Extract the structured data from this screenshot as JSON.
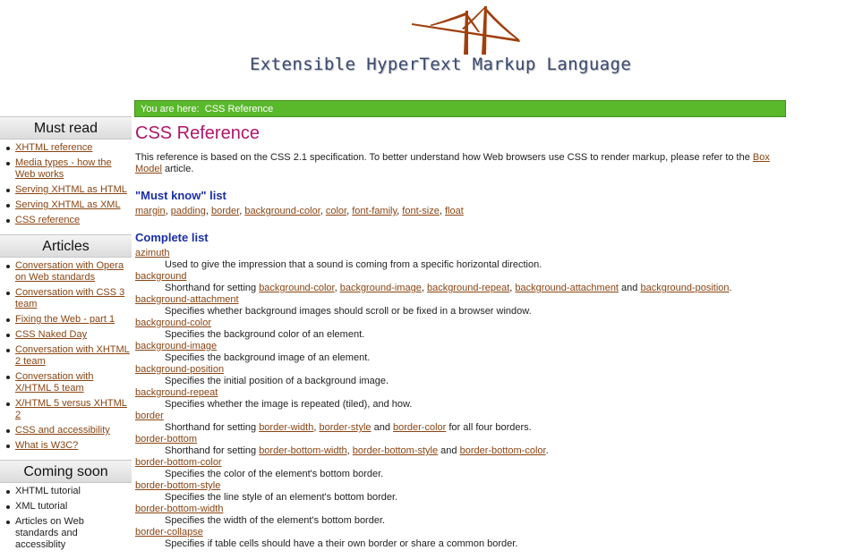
{
  "header": {
    "site_title": "Extensible HyperText Markup Language"
  },
  "breadcrumb": {
    "prefix": "You are here:",
    "current": "CSS Reference"
  },
  "sidebar": {
    "must_read": {
      "title": "Must read",
      "items": [
        "XHTML reference",
        "Media types - how the Web works",
        "Serving XHTML as HTML",
        "Serving XHTML as XML",
        "CSS reference"
      ]
    },
    "articles": {
      "title": "Articles",
      "items": [
        "Conversation with Opera on Web standards",
        "Conversation with CSS 3 team",
        "Fixing the Web - part 1",
        "CSS Naked Day",
        "Conversation with XHTML 2 team",
        "Conversation with X/HTML 5 team",
        "X/HTML 5 versus XHTML 2",
        "CSS and accessibility",
        "What is W3C?"
      ]
    },
    "coming_soon": {
      "title": "Coming soon",
      "items": [
        "XHTML tutorial",
        "XML tutorial",
        "Articles on Web standards and accessiblity"
      ]
    }
  },
  "main": {
    "title": "CSS Reference",
    "intro_pre": "This reference is based on the CSS 2.1 specification. To better understand how Web browsers use CSS to render markup, please refer to the",
    "intro_link": "Box Model",
    "intro_post": "article.",
    "must_know_heading": "\"Must know\" list",
    "must_know": [
      "margin",
      "padding",
      "border",
      "background-color",
      "color",
      "font-family",
      "font-size",
      "float"
    ],
    "complete_heading": "Complete list",
    "terms": [
      {
        "name": "azimuth",
        "desc": [
          {
            "t": "Used to give the impression that a sound is coming from a specific horizontal direction."
          }
        ]
      },
      {
        "name": "background",
        "desc": [
          {
            "t": "Shorthand for setting "
          },
          {
            "l": "background-color"
          },
          {
            "t": ", "
          },
          {
            "l": "background-image"
          },
          {
            "t": ", "
          },
          {
            "l": "background-repeat"
          },
          {
            "t": ", "
          },
          {
            "l": "background-attachment"
          },
          {
            "t": " and "
          },
          {
            "l": "background-position"
          },
          {
            "t": "."
          }
        ]
      },
      {
        "name": "background-attachment",
        "desc": [
          {
            "t": "Specifies whether background images should scroll or be fixed in a browser window."
          }
        ]
      },
      {
        "name": "background-color",
        "desc": [
          {
            "t": "Specifies the background color of an element."
          }
        ]
      },
      {
        "name": "background-image",
        "desc": [
          {
            "t": "Specifies the background image of an element."
          }
        ]
      },
      {
        "name": "background-position",
        "desc": [
          {
            "t": "Specifies the initial position of a background image."
          }
        ]
      },
      {
        "name": "background-repeat",
        "desc": [
          {
            "t": "Specifies whether the image is repeated (tiled), and how."
          }
        ]
      },
      {
        "name": "border",
        "desc": [
          {
            "t": "Shorthand for setting "
          },
          {
            "l": "border-width"
          },
          {
            "t": ", "
          },
          {
            "l": "border-style"
          },
          {
            "t": " and "
          },
          {
            "l": "border-color"
          },
          {
            "t": " for all four borders."
          }
        ]
      },
      {
        "name": "border-bottom",
        "desc": [
          {
            "t": "Shorthand for setting "
          },
          {
            "l": "border-bottom-width"
          },
          {
            "t": ", "
          },
          {
            "l": "border-bottom-style"
          },
          {
            "t": " and "
          },
          {
            "l": "border-bottom-color"
          },
          {
            "t": "."
          }
        ]
      },
      {
        "name": "border-bottom-color",
        "desc": [
          {
            "t": "Specifies the color of the element's bottom border."
          }
        ]
      },
      {
        "name": "border-bottom-style",
        "desc": [
          {
            "t": "Specifies the line style of an element's bottom border."
          }
        ]
      },
      {
        "name": "border-bottom-width",
        "desc": [
          {
            "t": "Specifies the width of the element's bottom border."
          }
        ]
      },
      {
        "name": "border-collapse",
        "desc": [
          {
            "t": "Specifies if table cells should have a their own border or share a common border."
          }
        ]
      }
    ]
  },
  "colors": {
    "breadcrumb_bg": "#5ab82b",
    "title": "#b0156a",
    "section_heading": "#1a2ea8",
    "link": "#8a4513",
    "logo": "#a0400e"
  }
}
